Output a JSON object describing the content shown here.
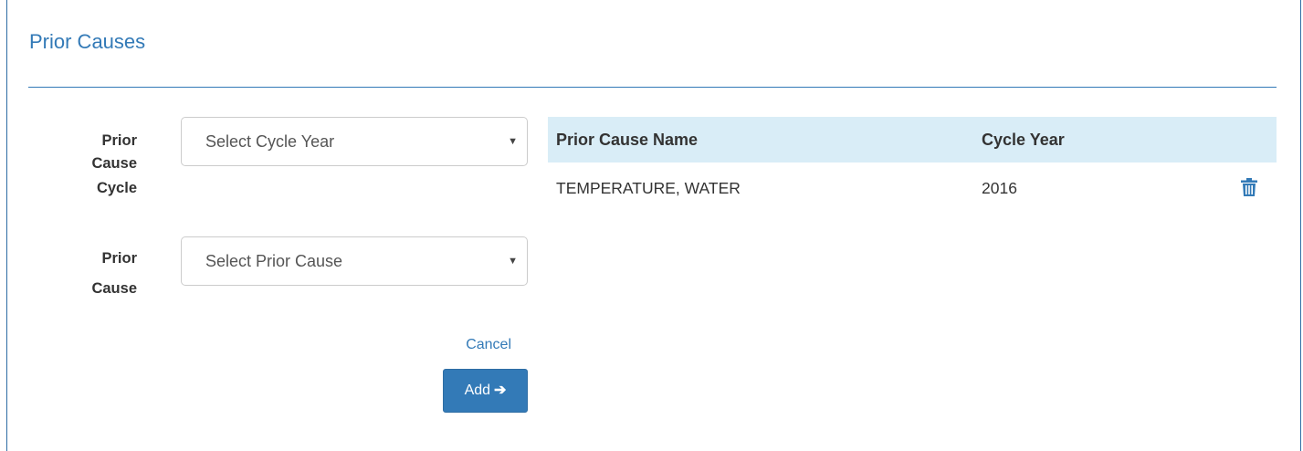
{
  "panel": {
    "title": "Prior Causes"
  },
  "form": {
    "cycle_label": "Prior Cause Cycle",
    "cycle_label_lines": [
      "Prior",
      "Cause",
      "Cycle"
    ],
    "cycle_select": {
      "selected": "Select Cycle Year"
    },
    "cause_label": "Prior Cause",
    "cause_label_lines": [
      "Prior",
      "Cause"
    ],
    "cause_select": {
      "selected": "Select Prior Cause"
    },
    "cancel_label": "Cancel",
    "add_label": "Add",
    "add_icon": "arrow-right-icon"
  },
  "table": {
    "columns": [
      "Prior Cause Name",
      "Cycle Year"
    ],
    "rows": [
      {
        "name": "TEMPERATURE, WATER",
        "year": "2016",
        "action_icon": "trash-icon"
      }
    ]
  },
  "colors": {
    "accent": "#337ab7",
    "header_bg": "#d9edf7",
    "border": "#cccccc"
  }
}
